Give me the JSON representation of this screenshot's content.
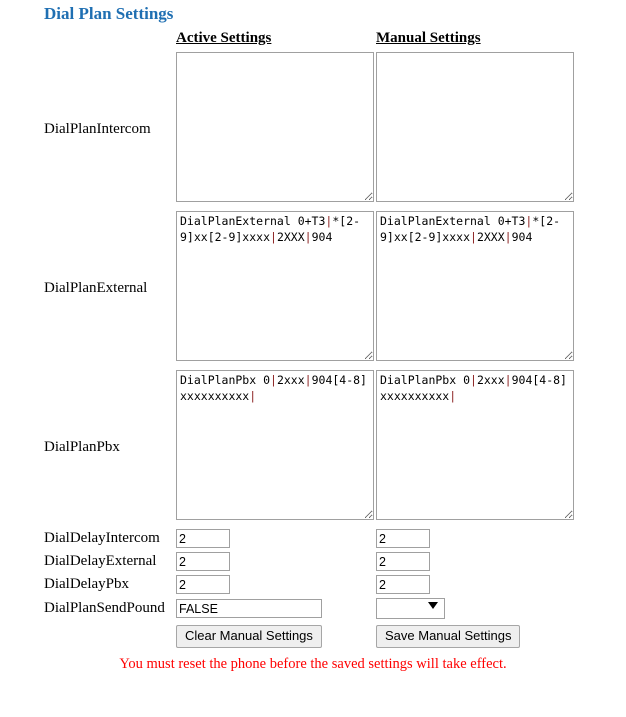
{
  "page": {
    "title": "Dial Plan Settings",
    "notice": "You must reset the phone before the saved settings will take effect."
  },
  "columns": {
    "label_header": "",
    "active_header": "Active Settings",
    "manual_header": "Manual Settings"
  },
  "textarea_rows": [
    {
      "label": "DialPlanIntercom",
      "active_value": "",
      "manual_value": ""
    },
    {
      "label": "DialPlanExternal",
      "active_value": "DialPlanExternal 0+T3|*[2-9]xx[2-9]xxxx|2XXX|904",
      "manual_value": "DialPlanExternal 0+T3|*[2-9]xx[2-9]xxxx|2XXX|904"
    },
    {
      "label": "DialPlanPbx",
      "active_value": "DialPlanPbx 0|2xxx|904[4-8]xxxxxxxxxx|",
      "manual_value": "DialPlanPbx 0|2xxx|904[4-8]xxxxxxxxxx|"
    }
  ],
  "input_rows": [
    {
      "label": "DialDelayIntercom",
      "active_value": "2",
      "manual_value": "2"
    },
    {
      "label": "DialDelayExternal",
      "active_value": "2",
      "manual_value": "2"
    },
    {
      "label": "DialDelayPbx",
      "active_value": "2",
      "manual_value": "2"
    }
  ],
  "send_pound_row": {
    "label": "DialPlanSendPound",
    "active_value": "FALSE",
    "manual_selected": "",
    "manual_options": [
      ""
    ]
  },
  "buttons": {
    "clear_label": "Clear Manual Settings",
    "save_label": "Save Manual Settings"
  },
  "colors": {
    "title": "#1F6FB2",
    "notice": "#FF0000",
    "pipe": "#8B2020",
    "field_border": "#a0a0a0"
  }
}
